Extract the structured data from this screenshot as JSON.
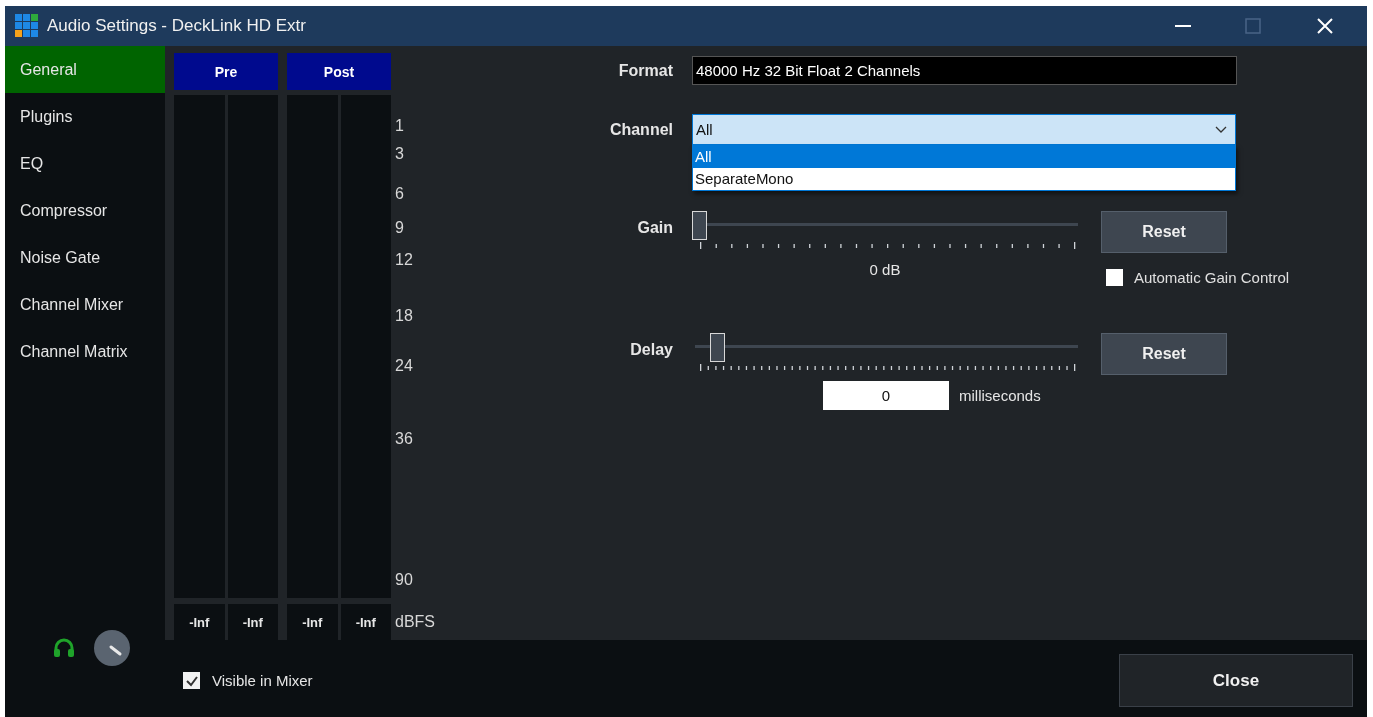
{
  "window": {
    "title": "Audio Settings - DeckLink HD Extr"
  },
  "sidebar": {
    "items": [
      {
        "label": "General",
        "selected": true
      },
      {
        "label": "Plugins",
        "selected": false
      },
      {
        "label": "EQ",
        "selected": false
      },
      {
        "label": "Compressor",
        "selected": false
      },
      {
        "label": "Noise Gate",
        "selected": false
      },
      {
        "label": "Channel Mixer",
        "selected": false
      },
      {
        "label": "Channel Matrix",
        "selected": false
      }
    ]
  },
  "meters": {
    "groups": [
      {
        "label": "Pre",
        "readings": [
          "-Inf",
          "-Inf"
        ]
      },
      {
        "label": "Post",
        "readings": [
          "-Inf",
          "-Inf"
        ]
      }
    ],
    "scale": [
      "1",
      "3",
      "6",
      "9",
      "12",
      "18",
      "24",
      "36",
      "90"
    ],
    "unit": "dBFS"
  },
  "format": {
    "label": "Format",
    "value": "48000 Hz 32 Bit Float 2 Channels"
  },
  "channel": {
    "label": "Channel",
    "value": "All",
    "expanded": true,
    "options": [
      {
        "label": "All",
        "selected": true
      },
      {
        "label": "SeparateMono",
        "selected": false
      }
    ]
  },
  "gain": {
    "label": "Gain",
    "level": 0,
    "reading": "0 dB",
    "button": "Reset",
    "agc": {
      "label": "Automatic Gain Control",
      "checked": false
    }
  },
  "delay": {
    "label": "Delay",
    "level": 0.05,
    "value": "0",
    "unit": "milliseconds",
    "button": "Reset"
  },
  "visible_in_mixer": {
    "label": "Visible in Mixer",
    "checked": true
  },
  "close_button": "Close"
}
